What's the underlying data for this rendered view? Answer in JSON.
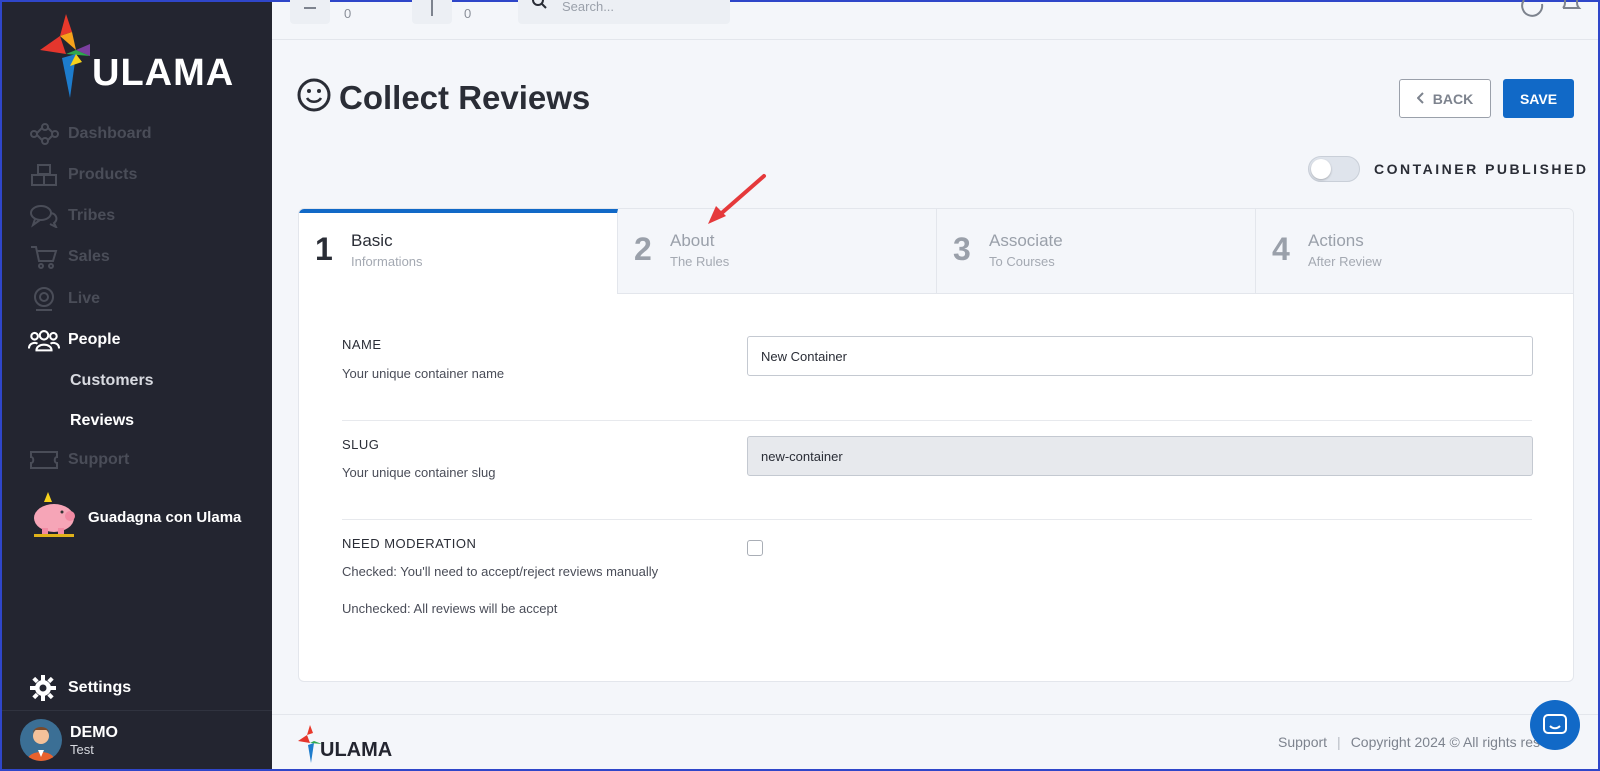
{
  "brand": {
    "name": "ULAMA"
  },
  "sidebar": {
    "items": [
      {
        "label": "Dashboard",
        "icon": "network-icon"
      },
      {
        "label": "Products",
        "icon": "boxes-icon"
      },
      {
        "label": "Tribes",
        "icon": "chat-bubbles-icon"
      },
      {
        "label": "Sales",
        "icon": "cart-icon"
      },
      {
        "label": "Live",
        "icon": "webcam-icon"
      },
      {
        "label": "People",
        "icon": "people-icon"
      }
    ],
    "sub_items": [
      {
        "label": "Customers"
      },
      {
        "label": "Reviews"
      }
    ],
    "support": {
      "label": "Support",
      "icon": "ticket-icon"
    },
    "promo": {
      "label": "Guadagna con Ulama",
      "icon": "piggy-bank-icon"
    },
    "settings": {
      "label": "Settings",
      "icon": "gear-icon"
    },
    "user": {
      "name": "DEMO",
      "role": "Test"
    }
  },
  "topbar": {
    "counter_1": "0",
    "counter_2": "0",
    "search_placeholder": "Search..."
  },
  "header": {
    "title": "Collect Reviews",
    "title_icon": "smiley-icon",
    "back_label": "BACK",
    "save_label": "SAVE",
    "toggle_label": "CONTAINER PUBLISHED",
    "toggle_on": false
  },
  "steps": [
    {
      "num": "1",
      "title": "Basic",
      "sub": "Informations"
    },
    {
      "num": "2",
      "title": "About",
      "sub": "The Rules"
    },
    {
      "num": "3",
      "title": "Associate",
      "sub": "To Courses"
    },
    {
      "num": "4",
      "title": "Actions",
      "sub": "After Review"
    }
  ],
  "form": {
    "name": {
      "label": "NAME",
      "help": "Your unique container name",
      "value": "New Container"
    },
    "slug": {
      "label": "SLUG",
      "help": "Your unique container slug",
      "value": "new-container"
    },
    "moderation": {
      "label": "NEED MODERATION",
      "help_checked": "Checked: You'll need to accept/reject reviews manually",
      "help_unchecked": "Unchecked: All reviews will be accept",
      "checked": false
    }
  },
  "footer": {
    "support_label": "Support",
    "copyright": "Copyright 2024 © All rights res"
  },
  "colors": {
    "accent": "#1169c7",
    "sidebar_bg": "#232530",
    "annotation": "#e5393b"
  }
}
